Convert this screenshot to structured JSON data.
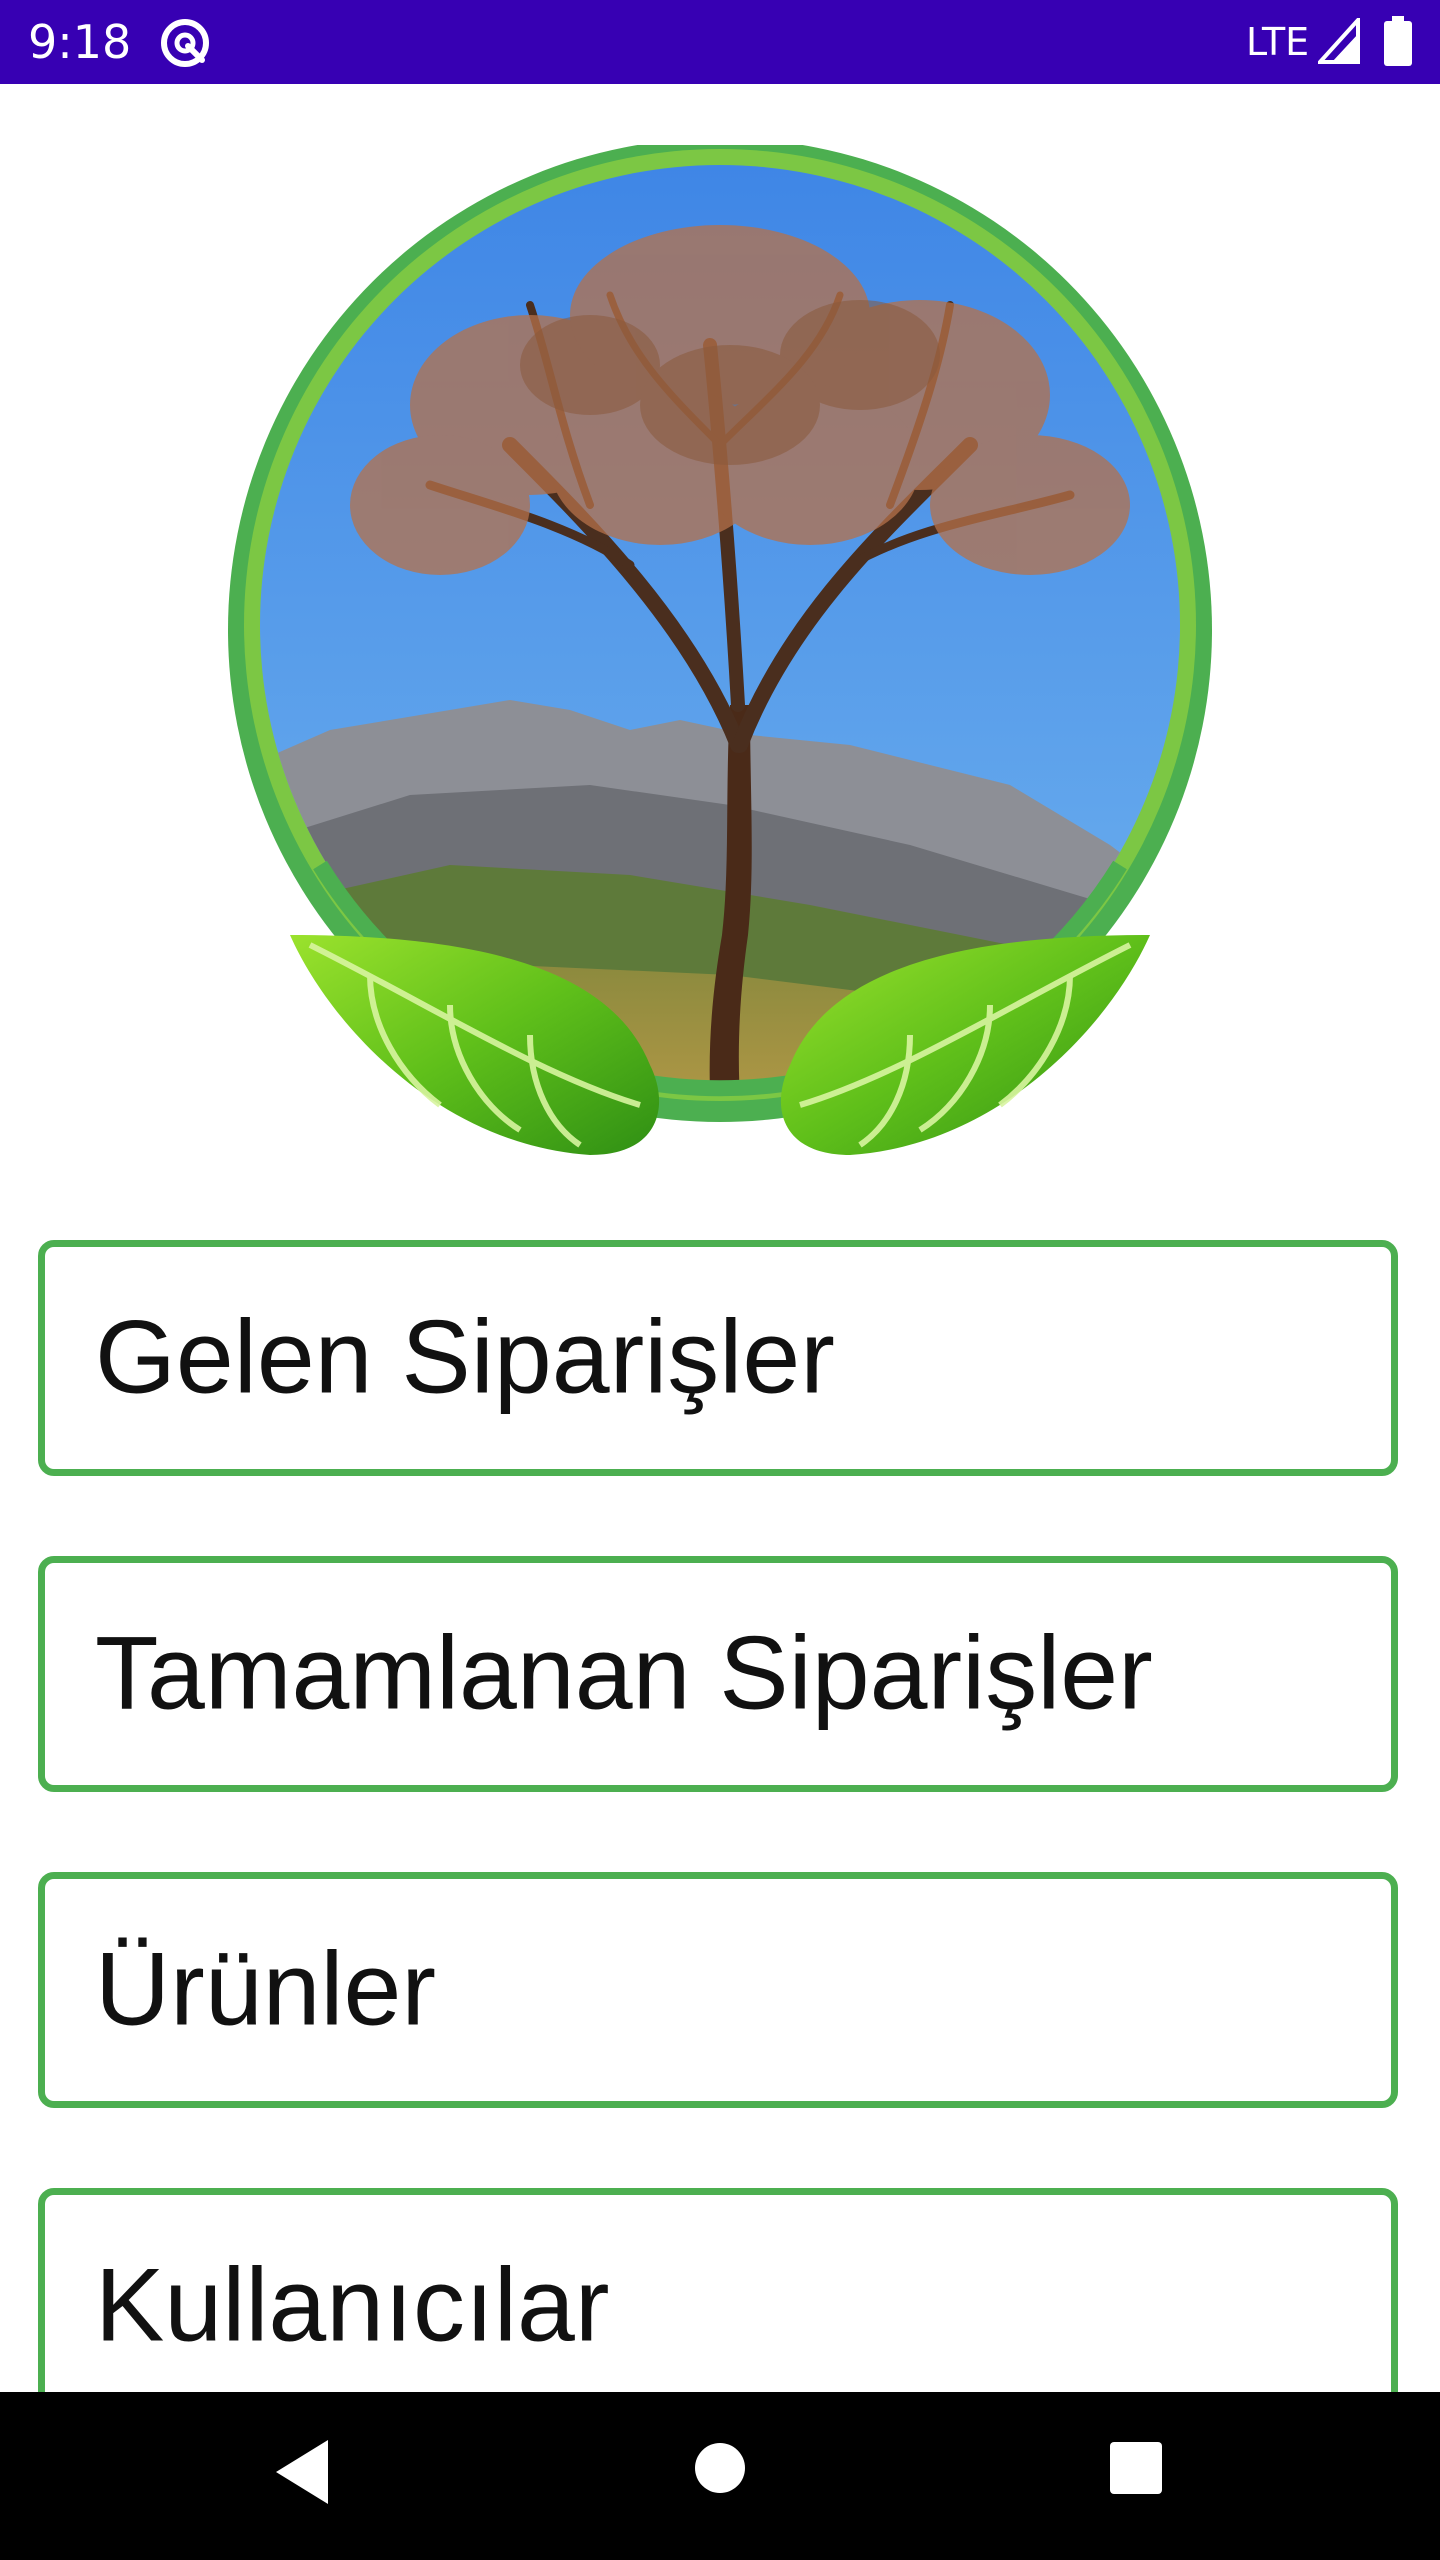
{
  "status_bar": {
    "time": "9:18",
    "network": "LTE",
    "icons": [
      "app-notification-icon",
      "signal-icon",
      "battery-icon"
    ],
    "background_color": "#3700b3"
  },
  "logo": {
    "description_icon": "tree-logo-icon",
    "ring_color": "#4caf50",
    "sky_color": "#4f9be8"
  },
  "menu": {
    "border_color": "#4caf50",
    "items": [
      {
        "label": "Gelen Siparişler"
      },
      {
        "label": "Tamamlanan Siparişler"
      },
      {
        "label": "Ürünler"
      },
      {
        "label": "Kullanıcılar"
      }
    ]
  },
  "nav_bar": {
    "buttons": [
      "back-icon",
      "home-icon",
      "recents-icon"
    ]
  }
}
